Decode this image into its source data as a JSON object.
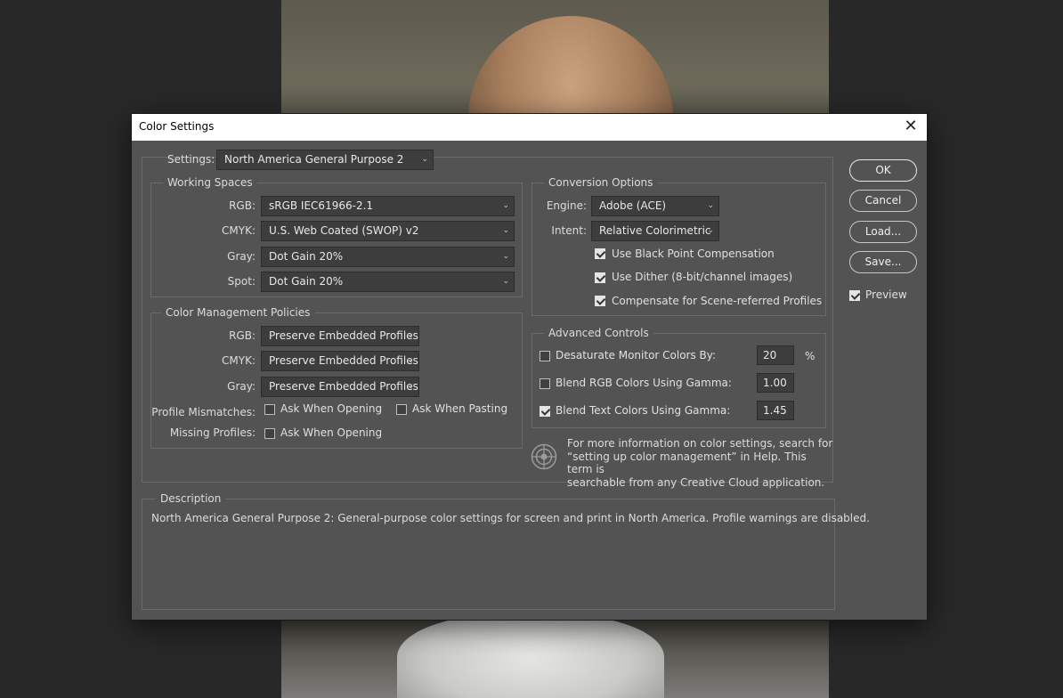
{
  "window": {
    "title": "Color Settings",
    "close_label": "✕"
  },
  "settings": {
    "label": "Settings:",
    "value": "North America General Purpose 2"
  },
  "working_spaces": {
    "legend": "Working Spaces",
    "rgb": {
      "label": "RGB:",
      "value": "sRGB IEC61966-2.1"
    },
    "cmyk": {
      "label": "CMYK:",
      "value": "U.S. Web Coated (SWOP) v2"
    },
    "gray": {
      "label": "Gray:",
      "value": "Dot Gain 20%"
    },
    "spot": {
      "label": "Spot:",
      "value": "Dot Gain 20%"
    }
  },
  "policies": {
    "legend": "Color Management Policies",
    "rgb": {
      "label": "RGB:",
      "value": "Preserve Embedded Profiles"
    },
    "cmyk": {
      "label": "CMYK:",
      "value": "Preserve Embedded Profiles"
    },
    "gray": {
      "label": "Gray:",
      "value": "Preserve Embedded Profiles"
    },
    "mismatches_label": "Profile Mismatches:",
    "ask_opening": {
      "label": "Ask When Opening",
      "checked": false
    },
    "ask_pasting": {
      "label": "Ask When Pasting",
      "checked": false
    },
    "missing_label": "Missing Profiles:",
    "missing_ask_opening": {
      "label": "Ask When Opening",
      "checked": false
    }
  },
  "conversion": {
    "legend": "Conversion Options",
    "engine": {
      "label": "Engine:",
      "value": "Adobe (ACE)"
    },
    "intent": {
      "label": "Intent:",
      "value": "Relative Colorimetric"
    },
    "black_point": {
      "label": "Use Black Point Compensation",
      "checked": true
    },
    "dither": {
      "label": "Use Dither (8-bit/channel images)",
      "checked": true
    },
    "scene_referred": {
      "label": "Compensate for Scene-referred Profiles",
      "checked": true
    }
  },
  "advanced": {
    "legend": "Advanced Controls",
    "desaturate": {
      "label": "Desaturate Monitor Colors By:",
      "value": "20",
      "unit": "%",
      "checked": false
    },
    "blend_rgb": {
      "label": "Blend RGB Colors Using Gamma:",
      "value": "1.00",
      "checked": false
    },
    "blend_text": {
      "label": "Blend Text Colors Using Gamma:",
      "value": "1.45",
      "checked": true
    }
  },
  "info": {
    "line1": "For more information on color settings, search for",
    "line2": "“setting up color management” in Help. This term is",
    "line3": "searchable from any Creative Cloud application."
  },
  "description": {
    "legend": "Description",
    "text": "North America General Purpose 2:  General-purpose color settings for screen and print in North America. Profile warnings are disabled."
  },
  "buttons": {
    "ok": "OK",
    "cancel": "Cancel",
    "load": "Load...",
    "save": "Save..."
  },
  "preview": {
    "label": "Preview",
    "checked": true
  },
  "colors": {
    "dialog_bg": "#535353",
    "field_bg": "#3d3d3d",
    "titlebar_bg": "#ffffff"
  }
}
